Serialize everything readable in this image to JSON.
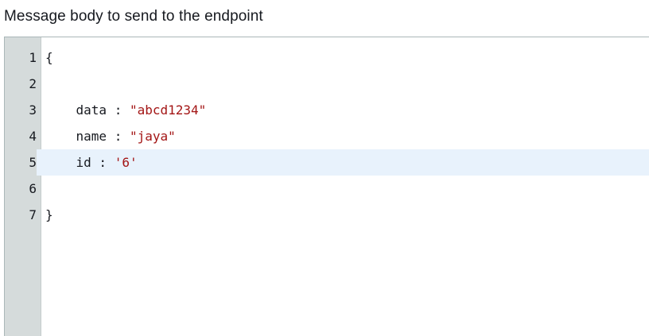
{
  "field": {
    "label": "Message body to send to the endpoint"
  },
  "editor": {
    "active_line": 5,
    "lines": [
      {
        "num": "1",
        "indent": "",
        "key": "",
        "sep": "",
        "value": "",
        "punct": "{"
      },
      {
        "num": "2",
        "indent": "",
        "key": "",
        "sep": "",
        "value": "",
        "punct": ""
      },
      {
        "num": "3",
        "indent": "    ",
        "key": "data",
        "sep": " : ",
        "value": "\"abcd1234\"",
        "punct": ""
      },
      {
        "num": "4",
        "indent": "    ",
        "key": "name",
        "sep": " : ",
        "value": "\"jaya\"",
        "punct": ""
      },
      {
        "num": "5",
        "indent": "    ",
        "key": "id",
        "sep": " : ",
        "value": "'6'",
        "punct": ""
      },
      {
        "num": "6",
        "indent": "",
        "key": "",
        "sep": "",
        "value": "",
        "punct": ""
      },
      {
        "num": "7",
        "indent": "",
        "key": "",
        "sep": "",
        "value": "",
        "punct": "}"
      }
    ]
  },
  "colors": {
    "gutter": "#d5dbdb",
    "active_line": "#e8f2fc",
    "string": "#a31515",
    "text": "#16191f"
  }
}
